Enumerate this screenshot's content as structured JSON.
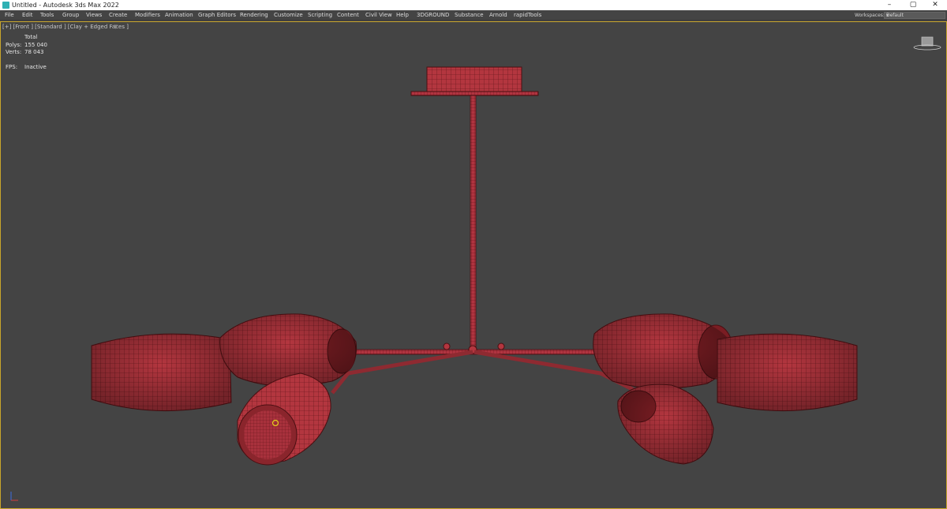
{
  "window": {
    "title": "Untitled - Autodesk 3ds Max 2022",
    "controls": {
      "minimize": "–",
      "maximize": "▢",
      "close": "✕"
    }
  },
  "menu": [
    {
      "label": "File"
    },
    {
      "label": "Edit"
    },
    {
      "label": "Tools"
    },
    {
      "label": "Group"
    },
    {
      "label": "Views"
    },
    {
      "label": "Create"
    },
    {
      "label": "Modifiers"
    },
    {
      "label": "Animation"
    },
    {
      "label": "Graph Editors"
    },
    {
      "label": "Rendering"
    },
    {
      "label": "Customize"
    },
    {
      "label": "Scripting"
    },
    {
      "label": "Content"
    },
    {
      "label": "Civil View"
    },
    {
      "label": "Help"
    },
    {
      "label": "3DGROUND"
    },
    {
      "label": "Substance"
    },
    {
      "label": "Arnold"
    },
    {
      "label": "rapidTools"
    }
  ],
  "workspaces": {
    "label": "Workspaces:",
    "value": "Default"
  },
  "viewport": {
    "label": "[+] [Front ] [Standard ] [Clay + Edged Faces ]",
    "stats": {
      "header": "Total",
      "polys_label": "Polys:",
      "polys_value": "155 040",
      "verts_label": "Verts:",
      "verts_value": "78 043",
      "fps_label": "FPS:",
      "fps_value": "Inactive"
    }
  },
  "colors": {
    "viewport_bg": "#444444",
    "mesh_fill": "#b3363f",
    "mesh_wire": "#5a1216",
    "active_border": "#c9a62b"
  },
  "icons": {
    "app": "3ds-max-icon",
    "viewcube": "viewcube-icon",
    "funnel": "filter-icon",
    "axis": "axis-tripod-icon"
  }
}
